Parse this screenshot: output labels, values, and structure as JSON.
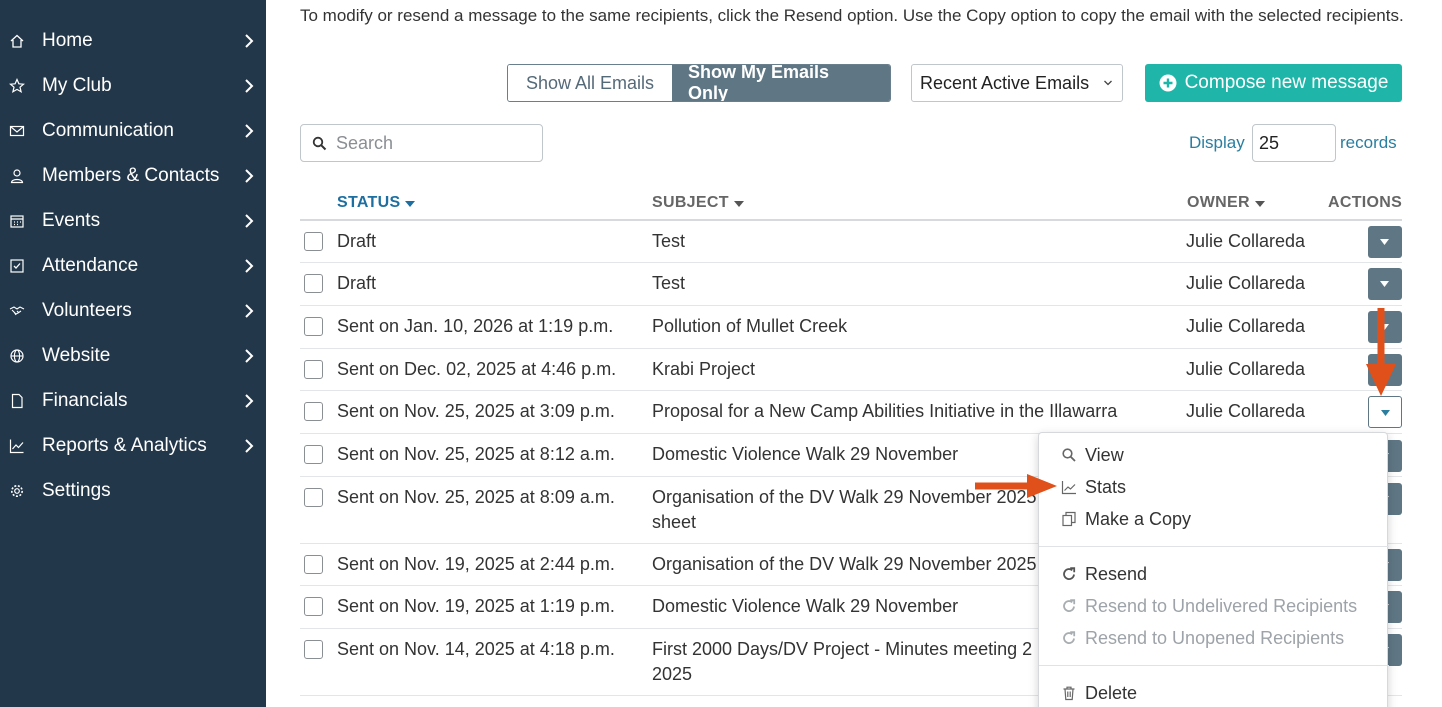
{
  "sidebar": {
    "items": [
      {
        "label": "Home",
        "icon": "home-icon"
      },
      {
        "label": "My Club",
        "icon": "star-icon"
      },
      {
        "label": "Communication",
        "icon": "envelope-icon"
      },
      {
        "label": "Members & Contacts",
        "icon": "user-icon"
      },
      {
        "label": "Events",
        "icon": "calendar-icon"
      },
      {
        "label": "Attendance",
        "icon": "check-square-icon"
      },
      {
        "label": "Volunteers",
        "icon": "handshake-icon"
      },
      {
        "label": "Website",
        "icon": "globe-icon"
      },
      {
        "label": "Financials",
        "icon": "document-icon"
      },
      {
        "label": "Reports & Analytics",
        "icon": "chart-icon"
      },
      {
        "label": "Settings",
        "icon": "gear-icon"
      }
    ]
  },
  "main": {
    "intro": "To modify or resend a message to the same recipients, click the Resend option. Use the Copy option to copy the email with the selected recipients.",
    "toggle": {
      "all": "Show All Emails",
      "mine": "Show My Emails Only"
    },
    "filter": {
      "selected": "Recent Active Emails"
    },
    "compose": "Compose new message",
    "search": {
      "placeholder": "Search"
    },
    "display": {
      "label": "Display",
      "value": "25",
      "suffix": "records"
    },
    "table": {
      "headers": {
        "status": "STATUS",
        "subject": "SUBJECT",
        "owner": "OWNER",
        "actions": "ACTIONS"
      },
      "rows": [
        {
          "status": "Draft",
          "subject": "Test",
          "owner": "Julie Collareda"
        },
        {
          "status": "Draft",
          "subject": "Test",
          "owner": "Julie Collareda"
        },
        {
          "status": "Sent on Jan. 10, 2026 at 1:19 p.m.",
          "subject": "Pollution of Mullet Creek",
          "owner": "Julie Collareda"
        },
        {
          "status": "Sent on Dec. 02, 2025 at 4:46 p.m.",
          "subject": "Krabi Project",
          "owner": "Julie Collareda"
        },
        {
          "status": "Sent on Nov. 25, 2025 at 3:09 p.m.",
          "subject": "Proposal for a New Camp Abilities Initiative in the Illawarra",
          "owner": "Julie Collareda"
        },
        {
          "status": "Sent on Nov. 25, 2025 at 8:12 a.m.",
          "subject": "Domestic Violence Walk 29 November",
          "owner": ""
        },
        {
          "status": "Sent on Nov. 25, 2025 at 8:09 a.m.",
          "subject": "Organisation of the DV Walk 29 November 2025",
          "subject2": "sheet",
          "owner": ""
        },
        {
          "status": "Sent on Nov. 19, 2025 at 2:44 p.m.",
          "subject": "Organisation of the DV Walk 29 November 2025",
          "owner": ""
        },
        {
          "status": "Sent on Nov. 19, 2025 at 1:19 p.m.",
          "subject": "Domestic Violence Walk 29 November",
          "owner": ""
        },
        {
          "status": "Sent on Nov. 14, 2025 at 4:18 p.m.",
          "subject": "First 2000 Days/DV Project - Minutes meeting 2",
          "subject2": "2025",
          "owner": ""
        }
      ]
    },
    "dropdown": {
      "view": "View",
      "stats": "Stats",
      "copy": "Make a Copy",
      "resend": "Resend",
      "resend_undelivered": "Resend to Undelivered Recipients",
      "resend_unopened": "Resend to Unopened Recipients",
      "delete": "Delete"
    }
  },
  "colors": {
    "sidebar_bg": "#23374a",
    "accent": "#1fb5a8",
    "action_button": "#5f7785",
    "annotation_arrow": "#e0501a"
  }
}
